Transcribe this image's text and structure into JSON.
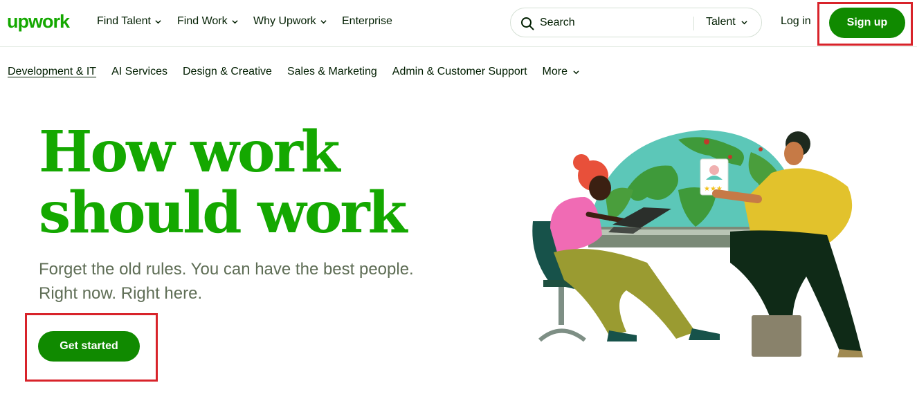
{
  "brand": {
    "name": "upwork",
    "color": "#14a800",
    "button_color": "#108a00",
    "highlight_color": "#d8232a"
  },
  "topnav": {
    "items": [
      {
        "label": "Find Talent",
        "icon": "chevron-down-icon"
      },
      {
        "label": "Find Work",
        "icon": "chevron-down-icon"
      },
      {
        "label": "Why Upwork",
        "icon": "chevron-down-icon"
      },
      {
        "label": "Enterprise"
      }
    ],
    "search": {
      "placeholder": "Search",
      "icon": "search-icon",
      "scope": "Talent",
      "scope_icon": "chevron-down-icon"
    },
    "login_label": "Log in",
    "signup_label": "Sign up"
  },
  "category_nav": {
    "items": [
      {
        "label": "Development & IT",
        "active": true
      },
      {
        "label": "AI Services"
      },
      {
        "label": "Design & Creative"
      },
      {
        "label": "Sales & Marketing"
      },
      {
        "label": "Admin & Customer Support"
      },
      {
        "label": "More",
        "icon": "chevron-down-icon"
      }
    ]
  },
  "hero": {
    "title_lines": [
      "How work",
      "should work"
    ],
    "subtitle_lines": [
      "Forget the old rules. You can have the best people.",
      "Right now. Right here."
    ],
    "cta_label": "Get started",
    "illustration": "people-collaborating-globe-illustration"
  }
}
